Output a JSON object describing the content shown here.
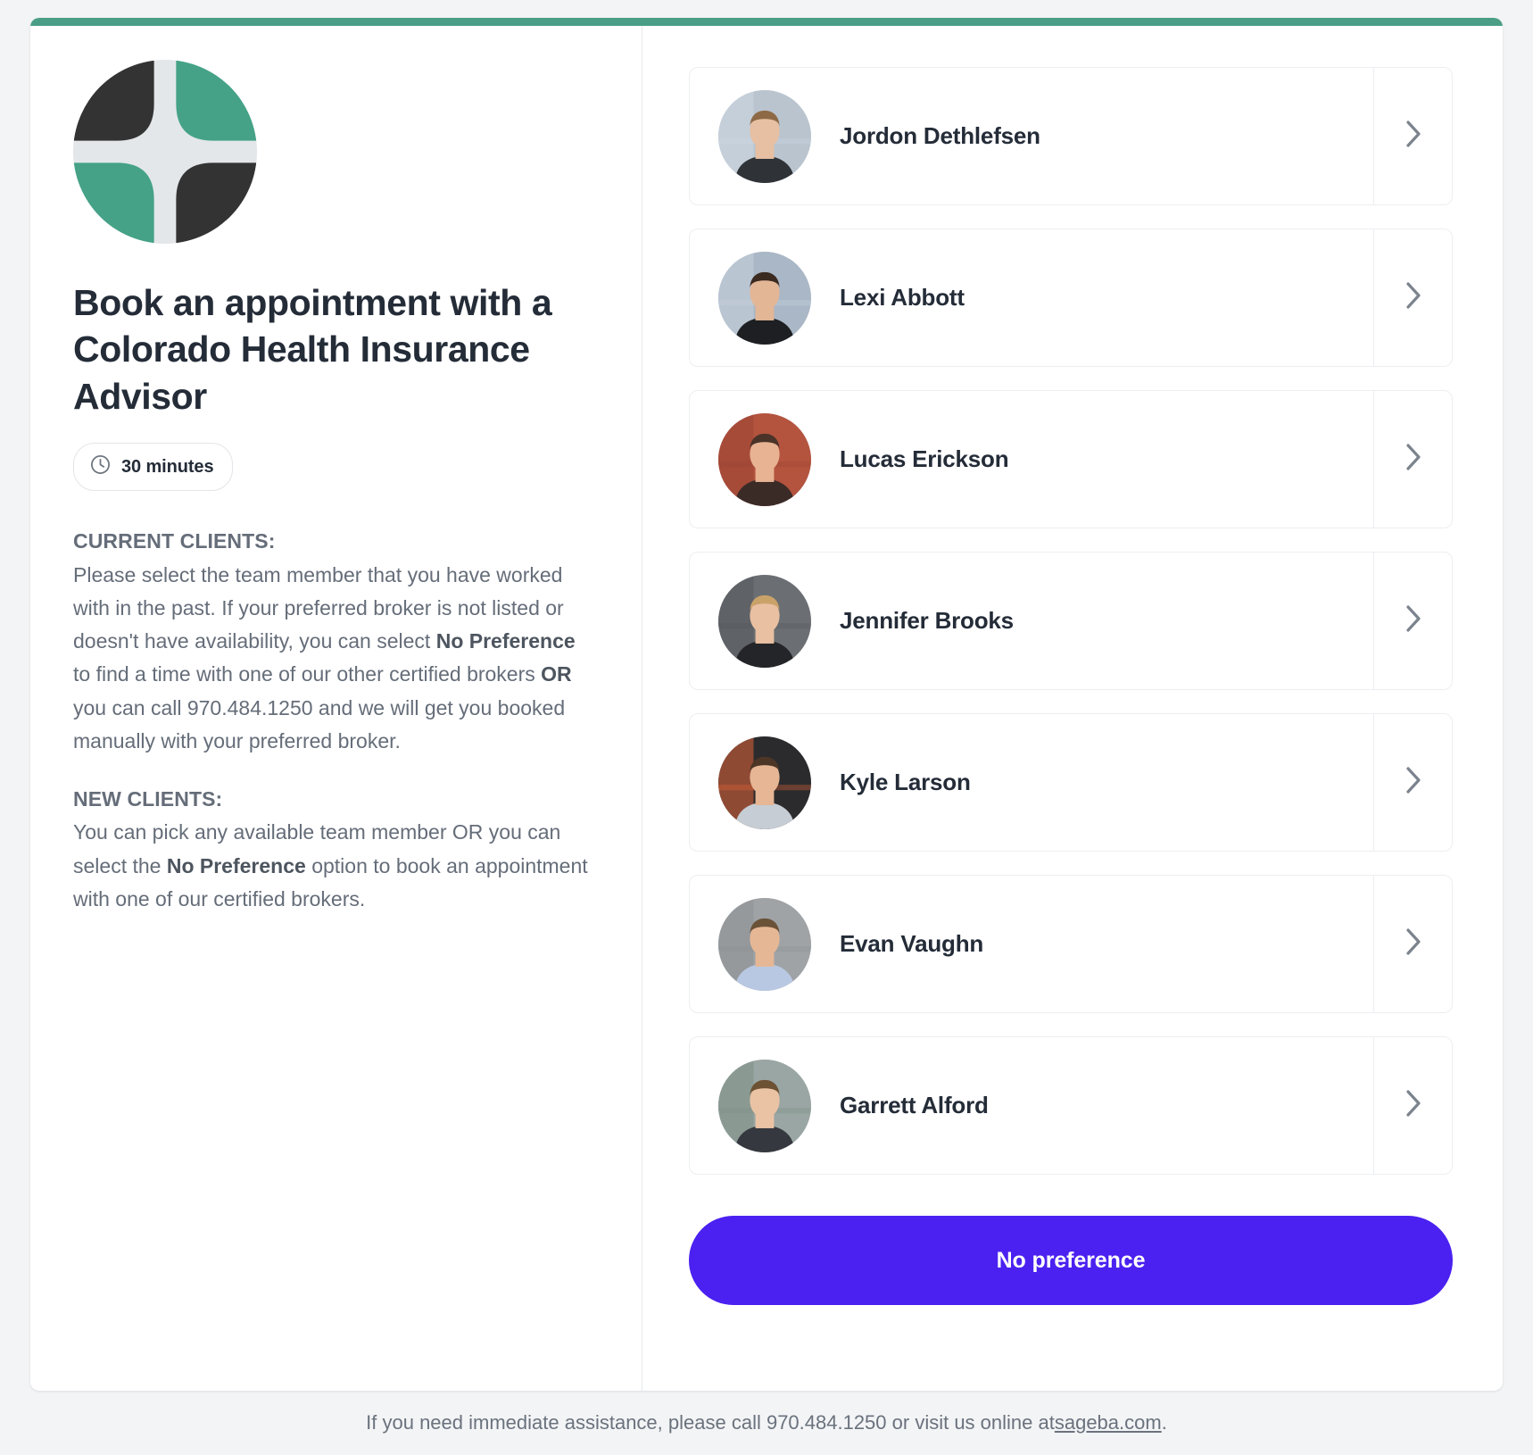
{
  "brand": {
    "accent_color": "#4a9e86",
    "logo_name": "sage-benefit-advisors-logo",
    "logo_green": "#45a287",
    "logo_dark": "#333333",
    "logo_light": "#e3e7ea"
  },
  "header": {
    "title": "Book an appointment with a Colorado Health Insurance Advisor",
    "duration": "30 minutes",
    "duration_icon": "clock-icon"
  },
  "description": {
    "current_clients_heading": "CURRENT CLIENTS:",
    "current_clients_parts": [
      {
        "text": "Please select the team member that you have worked with in the past. If your preferred broker is not listed or doesn't have availability, you can select ",
        "bold": false
      },
      {
        "text": "No Preference",
        "bold": true
      },
      {
        "text": " to find a time with one of our other certified brokers ",
        "bold": false
      },
      {
        "text": "OR",
        "bold": true
      },
      {
        "text": " you can call 970.484.1250 and we will get you booked manually with your preferred broker.",
        "bold": false
      }
    ],
    "new_clients_heading": "NEW CLIENTS:",
    "new_clients_parts": [
      {
        "text": "You can pick any available team member OR you can select the ",
        "bold": false
      },
      {
        "text": "No Preference",
        "bold": true
      },
      {
        "text": " option to book an appointment with one of our certified brokers.",
        "bold": false
      }
    ]
  },
  "team": {
    "chevron_icon": "chevron-right-icon",
    "members": [
      {
        "name": "Jordon Dethlefsen",
        "avatar_name": "avatar-jordon-dethlefsen",
        "bg": "#b9c4cf",
        "skin": "#e7bfa2",
        "hair": "#8d6a45",
        "shirt": "#2f3338",
        "accent": "#cfd8e2"
      },
      {
        "name": "Lexi Abbott",
        "avatar_name": "avatar-lexi-abbott",
        "bg": "#aab7c6",
        "skin": "#e3b696",
        "hair": "#3b2a20",
        "shirt": "#1d1f22",
        "accent": "#c7d2dd"
      },
      {
        "name": "Lucas Erickson",
        "avatar_name": "avatar-lucas-erickson",
        "bg": "#b4543e",
        "skin": "#e8b393",
        "hair": "#4a3328",
        "shirt": "#3a2b27",
        "accent": "#9c4434"
      },
      {
        "name": "Jennifer Brooks",
        "avatar_name": "avatar-jennifer-brooks",
        "bg": "#6b6f73",
        "skin": "#e9c0a1",
        "hair": "#c9a26a",
        "shirt": "#242528",
        "accent": "#55585c"
      },
      {
        "name": "Kyle Larson",
        "avatar_name": "avatar-kyle-larson",
        "bg": "#2b2b2d",
        "skin": "#e6b695",
        "hair": "#4d3626",
        "shirt": "#c6cdd4",
        "accent": "#e2643a"
      },
      {
        "name": "Evan Vaughn",
        "avatar_name": "avatar-evan-vaughn",
        "bg": "#9fa3a6",
        "skin": "#e6b795",
        "hair": "#6a5238",
        "shirt": "#b9c8e2",
        "accent": "#8d9194"
      },
      {
        "name": "Garrett Alford",
        "avatar_name": "avatar-garrett-alford",
        "bg": "#9aa6a3",
        "skin": "#eac3a4",
        "hair": "#6d5133",
        "shirt": "#35383e",
        "accent": "#7d8f86"
      }
    ]
  },
  "actions": {
    "no_preference_label": "No preference",
    "no_preference_color": "#4a21f0"
  },
  "footer": {
    "text_before": "If you need immediate assistance, please call 970.484.1250 or visit us online at ",
    "link_text": "sageba.com",
    "text_after": "."
  }
}
